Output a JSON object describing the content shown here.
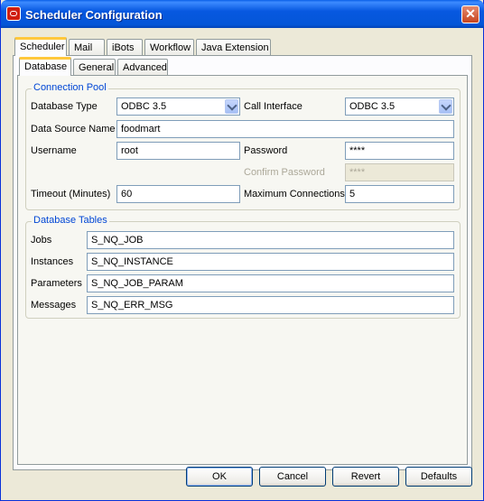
{
  "window": {
    "title": "Scheduler Configuration",
    "close_glyph": "✕"
  },
  "main_tabs": [
    {
      "label": "Scheduler"
    },
    {
      "label": "Mail"
    },
    {
      "label": "iBots"
    },
    {
      "label": "Workflow"
    },
    {
      "label": "Java Extension"
    }
  ],
  "sub_tabs": [
    {
      "label": "Database"
    },
    {
      "label": "General"
    },
    {
      "label": "Advanced"
    }
  ],
  "connection_pool": {
    "title": "Connection Pool",
    "database_type_label": "Database Type",
    "database_type_value": "ODBC 3.5",
    "call_interface_label": "Call Interface",
    "call_interface_value": "ODBC 3.5",
    "data_source_name_label": "Data Source Name",
    "data_source_name_value": "foodmart",
    "username_label": "Username",
    "username_value": "root",
    "password_label": "Password",
    "password_value": "****",
    "confirm_password_label": "Confirm Password",
    "confirm_password_value": "****",
    "timeout_label": "Timeout (Minutes)",
    "timeout_value": "60",
    "max_connections_label": "Maximum Connections",
    "max_connections_value": "5"
  },
  "database_tables": {
    "title": "Database Tables",
    "jobs_label": "Jobs",
    "jobs_value": "S_NQ_JOB",
    "instances_label": "Instances",
    "instances_value": "S_NQ_INSTANCE",
    "parameters_label": "Parameters",
    "parameters_value": "S_NQ_JOB_PARAM",
    "messages_label": "Messages",
    "messages_value": "S_NQ_ERR_MSG"
  },
  "buttons": {
    "ok": "OK",
    "cancel": "Cancel",
    "revert": "Revert",
    "defaults": "Defaults"
  },
  "colors": {
    "title_bar": "#0758e0",
    "group_title": "#0046d5",
    "active_tab_accent": "#ffc83c",
    "close_button": "#c7451e"
  }
}
